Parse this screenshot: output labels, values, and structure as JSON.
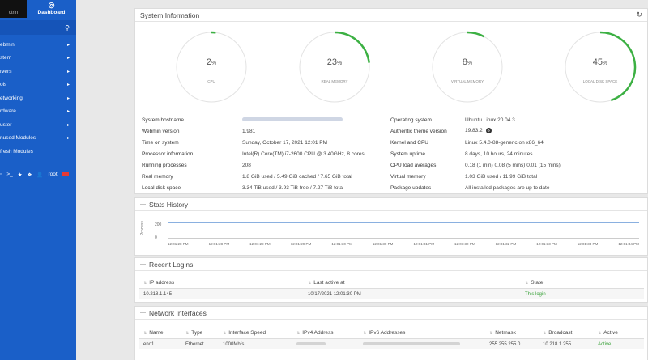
{
  "sidebar": {
    "thumb_label": "ctrin",
    "dashboard_label": "Dashboard",
    "items": [
      {
        "label": "ebmin"
      },
      {
        "label": "stem"
      },
      {
        "label": "rvers"
      },
      {
        "label": "ols"
      },
      {
        "label": "etworking"
      },
      {
        "label": "rdware"
      },
      {
        "label": "uster"
      },
      {
        "label": "nused Modules"
      },
      {
        "label": "fresh Modules"
      }
    ],
    "bottom_user": "root"
  },
  "system_info": {
    "title": "System Information",
    "gauges": [
      {
        "value": "2",
        "pct": "%",
        "label": "CPU",
        "fraction": 0.02
      },
      {
        "value": "23",
        "pct": "%",
        "label": "REAL MEMORY",
        "fraction": 0.23
      },
      {
        "value": "8",
        "pct": "%",
        "label": "VIRTUAL MEMORY",
        "fraction": 0.08
      },
      {
        "value": "45",
        "pct": "%",
        "label": "LOCAL DISK SPACE",
        "fraction": 0.45
      }
    ],
    "rows": [
      {
        "k1": "System hostname",
        "v1": "",
        "k2": "Operating system",
        "v2": "Ubuntu Linux 20.04.3"
      },
      {
        "k1": "Webmin version",
        "v1": "1.981",
        "k2": "Authentic theme version",
        "v2": "19.83.2"
      },
      {
        "k1": "Time on system",
        "v1": "Sunday, October 17, 2021 12:01 PM",
        "k2": "Kernel and CPU",
        "v2": "Linux 5.4.0-88-generic on x86_64"
      },
      {
        "k1": "Processor information",
        "v1": "Intel(R) Core(TM) i7-2600 CPU @ 3.40GHz, 8 cores",
        "k2": "System uptime",
        "v2": "8 days, 10 hours, 24 minutes"
      },
      {
        "k1": "Running processes",
        "v1": "208",
        "k2": "CPU load averages",
        "v2": "0.18 (1 min) 0.08 (5 mins) 0.01 (15 mins)"
      },
      {
        "k1": "Real memory",
        "v1": "1.8 GiB used / 5.49 GiB cached / 7.65 GiB total",
        "k2": "Virtual memory",
        "v2": "1.03 GiB used / 11.99 GiB total"
      },
      {
        "k1": "Local disk space",
        "v1": "3.34 TiB used / 3.93 TiB free / 7.27 TiB total",
        "k2": "Package updates",
        "v2": "All installed packages are up to date"
      }
    ]
  },
  "stats_history": {
    "title": "Stats History",
    "ylabel": "Process",
    "yticks": [
      "200",
      "0"
    ],
    "xticks": [
      "12:01:28 PM",
      "12:01:28 PM",
      "12:01:29 PM",
      "12:01:29 PM",
      "12:01:30 PM",
      "12:01:30 PM",
      "12:01:31 PM",
      "12:01:32 PM",
      "12:01:32 PM",
      "12:01:33 PM",
      "12:01:33 PM",
      "12:01:34 PM"
    ]
  },
  "recent_logins": {
    "title": "Recent Logins",
    "headers": [
      "IP address",
      "Last active at",
      "State"
    ],
    "rows": [
      {
        "ip": "10.218.1.145",
        "last": "10/17/2021 12:01:30 PM",
        "state": "This login"
      }
    ]
  },
  "network_interfaces": {
    "title": "Network Interfaces",
    "headers": [
      "Name",
      "Type",
      "Interface Speed",
      "IPv4 Address",
      "IPv6 Addresses",
      "Netmask",
      "Broadcast",
      "Active"
    ],
    "rows": [
      {
        "name": "eno1",
        "type": "Ethernet",
        "speed": "1000Mb/s",
        "netmask": "255.255.255.0",
        "broadcast": "10.218.1.255",
        "active": "Active"
      }
    ]
  }
}
